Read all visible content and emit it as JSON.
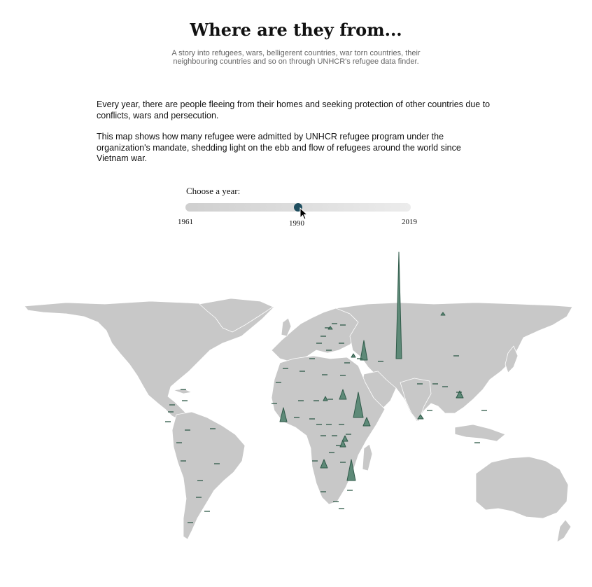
{
  "header": {
    "title": "Where are they from...",
    "subtitle": "A story into refugees, wars, belligerent countries, war torn countries, their neighbouring countries and so on through UNHCR's refugee data finder."
  },
  "intro": {
    "p1": "Every year, there are people fleeing from their homes and seeking protection of other countries due to conflicts, wars and persecution.",
    "p2": "This map shows how many refugee were admitted by UNHCR refugee program under the organization's mandate, shedding light on the ebb and flow of refugees around the world since Vietnam war."
  },
  "slider": {
    "label": "Choose a year:",
    "min": "1961",
    "max": "2019",
    "current": "1990",
    "value_fraction": 0.5
  },
  "colors": {
    "land": "#c8c8c8",
    "spike_fill": "#5e8a78",
    "spike_stroke": "#2f5a49",
    "thumb": "#1f4e5f"
  }
}
